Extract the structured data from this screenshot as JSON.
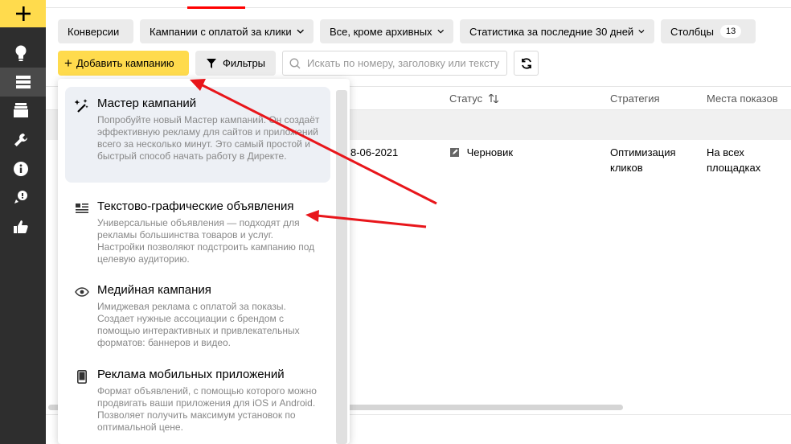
{
  "sidebar": {
    "icons": [
      "plus-icon",
      "lightbulb-icon",
      "campaigns-list-icon",
      "archive-icon",
      "wrench-icon",
      "info-icon",
      "rocket-icon",
      "thumbs-up-icon"
    ],
    "accent_color": "#ffdb4d"
  },
  "toolbar": {
    "conversions": "Конверсии",
    "campaign_type": "Кампании с оплатой за клики",
    "archive_filter": "Все, кроме архивных",
    "stats_period": "Статистика за последние 30 дней",
    "columns": "Столбцы",
    "columns_count": "13",
    "add_campaign": "Добавить кампанию",
    "filters": "Фильтры",
    "search_placeholder": "Искать по номеру, заголовку или тексту"
  },
  "table": {
    "headers": {
      "status": "Статус",
      "strategy": "Стратегия",
      "placements": "Места показов"
    },
    "row": {
      "date": "8-06-2021",
      "status": "Черновик",
      "strategy_line1": "Оптимизация",
      "strategy_line2": "кликов",
      "placements_line1": "На всех",
      "placements_line2": "площадках"
    }
  },
  "dropdown": {
    "items": [
      {
        "title": "Мастер кампаний",
        "desc": "Попробуйте новый Мастер кампаний. Он создаёт эффективную рекламу для сайтов и приложений всего за несколько минут. Это самый простой и быстрый способ начать работу в Директе.",
        "icon": "magic-wand-icon"
      },
      {
        "title": "Текстово-графические объявления",
        "desc": "Универсальные объявления — подходят для рекламы большинства товаров и услуг. Настройки позволяют подстроить кампанию под целевую аудиторию.",
        "icon": "text-lines-icon"
      },
      {
        "title": "Медийная кампания",
        "desc": "Имиджевая реклама с оплатой за показы. Создает нужные ассоциации с брендом с помощью интерактивных и привлекательных форматов: баннеров и видео.",
        "icon": "eye-icon"
      },
      {
        "title": "Реклама мобильных приложений",
        "desc": "Формат объявлений, с помощью которого можно продвигать ваши приложения для iOS и Android. Позволяет получить максимум установок по оптимальной цене.",
        "icon": "smartphone-icon"
      }
    ]
  },
  "annotation_color": "#e8161b"
}
